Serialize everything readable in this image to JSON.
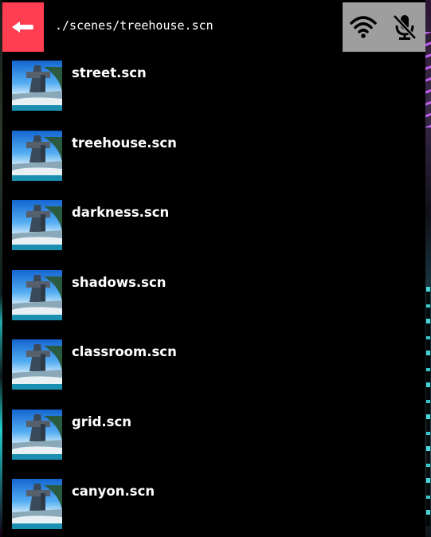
{
  "header": {
    "back_icon": "back-arrow-icon",
    "path": "./scenes/treehouse.scn",
    "status_icons": [
      "wifi-icon",
      "microphone-muted-icon"
    ]
  },
  "colors": {
    "back_button": "#ff3e52",
    "status_box": "#9e9e9e",
    "background": "#000000",
    "text": "#ffffff"
  },
  "files": [
    {
      "name": "street.scn"
    },
    {
      "name": "treehouse.scn"
    },
    {
      "name": "darkness.scn"
    },
    {
      "name": "shadows.scn"
    },
    {
      "name": "classroom.scn"
    },
    {
      "name": "grid.scn"
    },
    {
      "name": "canyon.scn"
    }
  ]
}
